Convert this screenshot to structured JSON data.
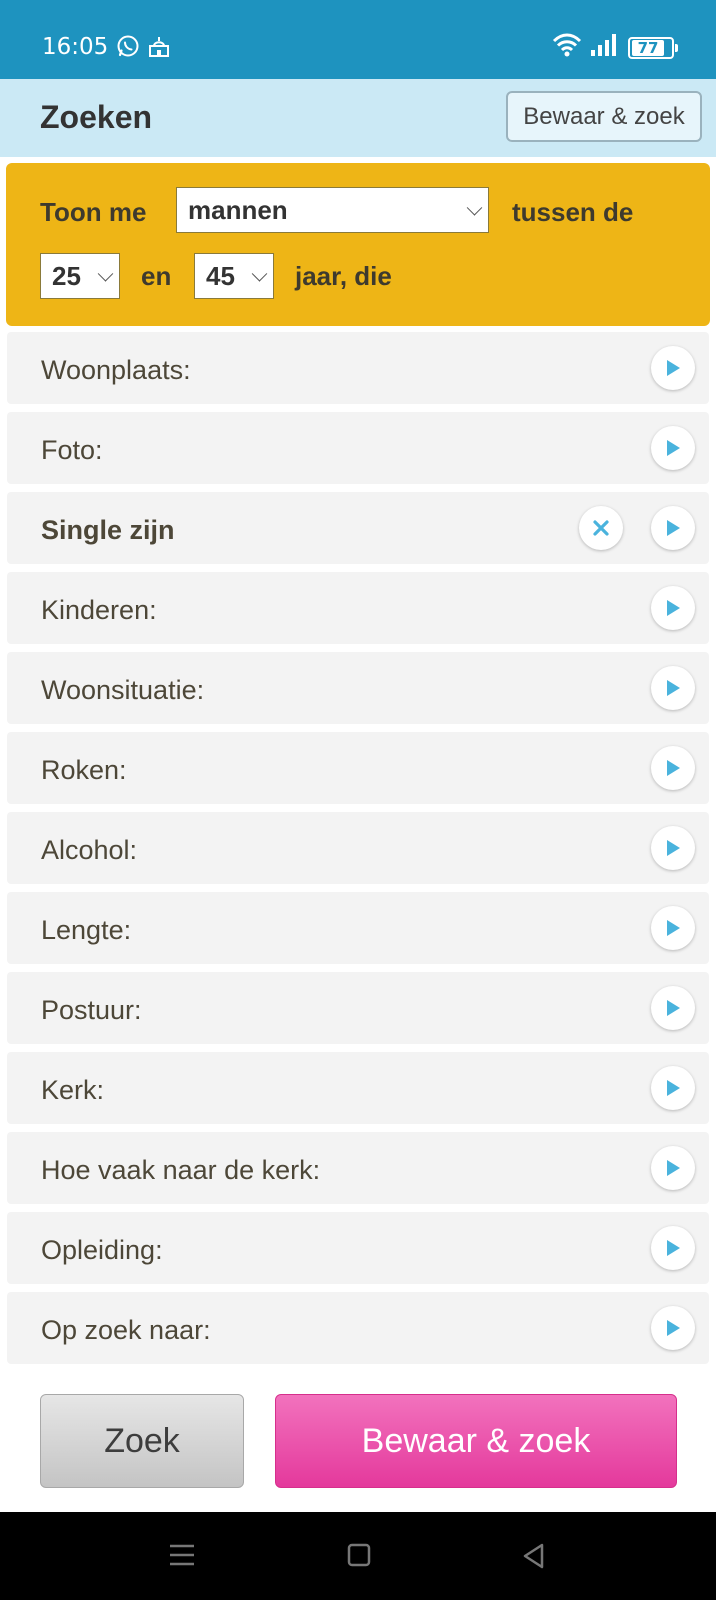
{
  "status_bar": {
    "time": "16:05",
    "battery": "77",
    "left_icons": [
      "whatsapp-icon",
      "mosque-icon"
    ],
    "right_icons": [
      "wifi-icon",
      "signal-icon",
      "battery-icon"
    ]
  },
  "header": {
    "title": "Zoeken",
    "save_search_label": "Bewaar & zoek"
  },
  "filter": {
    "show_me_label": "Toon me",
    "gender_value": "mannen",
    "between_label": "tussen de",
    "age_min": "25",
    "and_label": "en",
    "age_max": "45",
    "years_label": "jaar, die"
  },
  "criteria": [
    {
      "label": "Woonplaats:",
      "bold": false,
      "clearable": false
    },
    {
      "label": "Foto:",
      "bold": false,
      "clearable": false
    },
    {
      "label": "Single zijn",
      "bold": true,
      "clearable": true
    },
    {
      "label": "Kinderen:",
      "bold": false,
      "clearable": false
    },
    {
      "label": "Woonsituatie:",
      "bold": false,
      "clearable": false
    },
    {
      "label": "Roken:",
      "bold": false,
      "clearable": false
    },
    {
      "label": "Alcohol:",
      "bold": false,
      "clearable": false
    },
    {
      "label": "Lengte:",
      "bold": false,
      "clearable": false
    },
    {
      "label": "Postuur:",
      "bold": false,
      "clearable": false
    },
    {
      "label": "Kerk:",
      "bold": false,
      "clearable": false
    },
    {
      "label": "Hoe vaak naar de kerk:",
      "bold": false,
      "clearable": false
    },
    {
      "label": "Opleiding:",
      "bold": false,
      "clearable": false
    },
    {
      "label": "Op zoek naar:",
      "bold": false,
      "clearable": false
    }
  ],
  "actions": {
    "search_label": "Zoek",
    "save_search_label": "Bewaar & zoek"
  },
  "colors": {
    "status_bar": "#1e93bf",
    "header_bg": "#cbe9f5",
    "filter_bg": "#eeb516",
    "accent_play": "#4ab3dd",
    "save_button": "#e4399c"
  },
  "nav_bar": [
    "menu-icon",
    "home-icon",
    "back-icon"
  ]
}
